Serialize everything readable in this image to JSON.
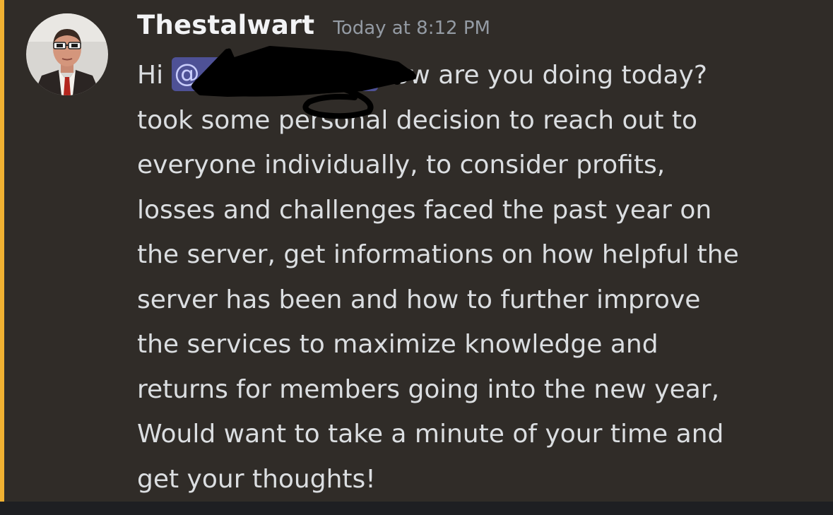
{
  "message": {
    "author": "Thestalwart",
    "timestamp": "Today at 8:12 PM",
    "greeting": "Hi",
    "mention_prefix": "@",
    "line1_tail": "how are you doing today?",
    "lines": [
      "took some personal decision to reach out to",
      "everyone individually, to consider profits,",
      "losses and challenges faced the past year on",
      "the server, get informations on how helpful the",
      "server has been and how to further improve",
      "the services to maximize knowledge and",
      "returns for members going into the new year,",
      "Would want to take a minute of your time and",
      "get your thoughts!"
    ]
  },
  "colors": {
    "message_background": "#302c28",
    "mention_highlight_bar": "#f0b132",
    "mention_pill": "#4e5196",
    "text": "#dbdee1",
    "username": "#f2f3f5",
    "timestamp": "#949ba4",
    "redaction": "#000000"
  },
  "icons": {
    "avatar": "user-avatar-man-with-sunglasses",
    "redaction": "black-scribble-redaction"
  }
}
